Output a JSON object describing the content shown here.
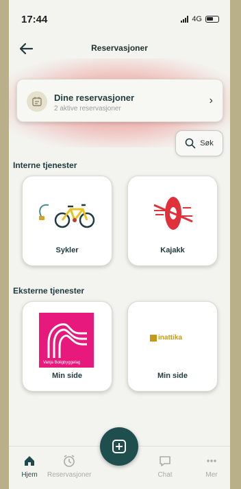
{
  "status_bar": {
    "time": "17:44",
    "network": "4G"
  },
  "header": {
    "title": "Reservasjoner"
  },
  "reservations_card": {
    "title": "Dine reservasjoner",
    "subtitle": "2 aktive reservasjoner"
  },
  "search": {
    "label": "Søk"
  },
  "internal": {
    "heading": "Interne tjenester",
    "tiles": [
      {
        "label": "Sykler",
        "icon": "bicycle-icon"
      },
      {
        "label": "Kajakk",
        "icon": "kayak-icon"
      }
    ]
  },
  "external": {
    "heading": "Eksterne tjenester",
    "tiles": [
      {
        "label": "Min side",
        "logo_text": "Vanja Boligbyggelag"
      },
      {
        "label": "Min side",
        "logo_text": "inattika"
      }
    ]
  },
  "nav": {
    "items": [
      {
        "label": "Hjem",
        "icon": "home-icon"
      },
      {
        "label": "Reservasjoner",
        "icon": "reservations-icon"
      },
      {
        "label": "Chat",
        "icon": "chat-icon"
      },
      {
        "label": "Mer",
        "icon": "more-icon"
      }
    ],
    "add_icon": "plus-icon"
  },
  "colors": {
    "accent": "#1f4e4f",
    "brand_pink": "#e8197d",
    "kayak_red": "#e0303a",
    "attika_gold": "#c49a16"
  }
}
